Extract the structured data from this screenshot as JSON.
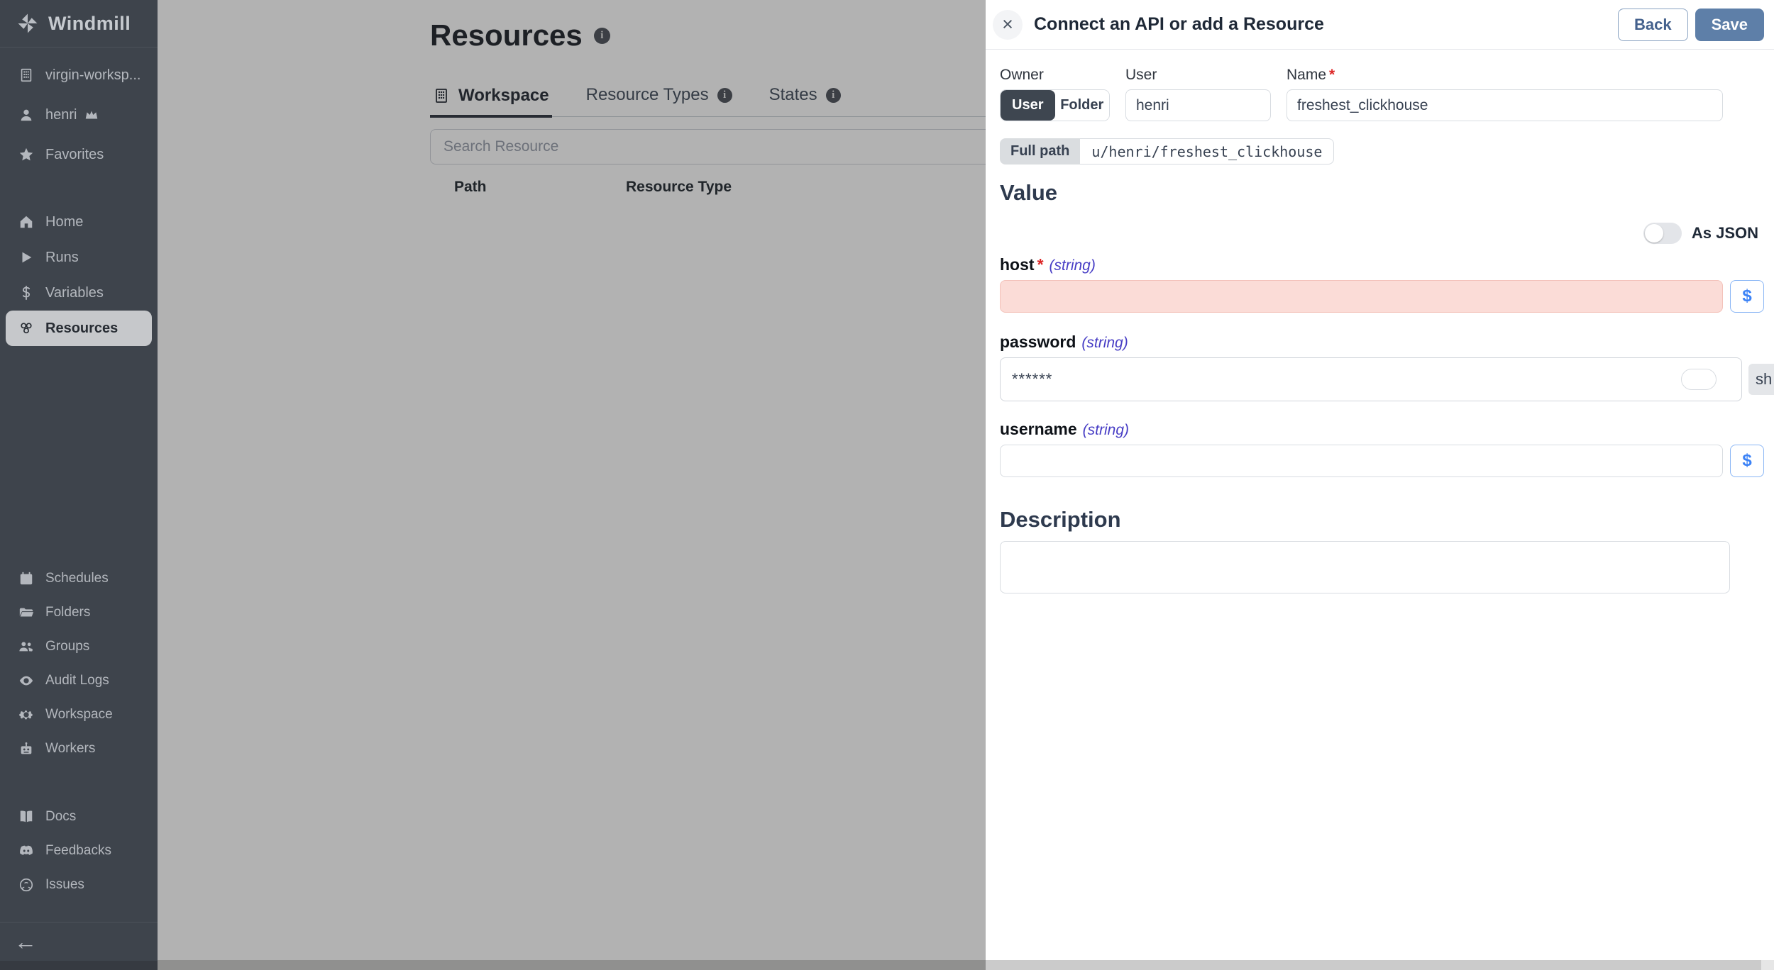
{
  "sidebar": {
    "logo_text": "Windmill",
    "workspace_name": "virgin-worksp...",
    "username": "henri",
    "favorites_label": "Favorites",
    "nav": [
      {
        "label": "Home"
      },
      {
        "label": "Runs"
      },
      {
        "label": "Variables"
      },
      {
        "label": "Resources"
      }
    ],
    "selected_nav": "Resources",
    "tools": [
      {
        "label": "Schedules"
      },
      {
        "label": "Folders"
      },
      {
        "label": "Groups"
      },
      {
        "label": "Audit Logs"
      },
      {
        "label": "Workspace"
      },
      {
        "label": "Workers"
      }
    ],
    "links": [
      {
        "label": "Docs"
      },
      {
        "label": "Feedbacks"
      },
      {
        "label": "Issues"
      }
    ],
    "collapse_icon": "←"
  },
  "main": {
    "title": "Resources",
    "tabs": [
      {
        "label": "Workspace"
      },
      {
        "label": "Resource Types"
      },
      {
        "label": "States"
      }
    ],
    "active_tab": "Workspace",
    "search_placeholder": "Search Resource",
    "table_columns": [
      "Path",
      "Resource Type"
    ]
  },
  "drawer": {
    "title": "Connect an API or add a Resource",
    "back_label": "Back",
    "save_label": "Save",
    "owner_label": "Owner",
    "owner_options": [
      {
        "label": "User",
        "selected": true
      },
      {
        "label": "Folder",
        "selected": false
      }
    ],
    "user_label": "User",
    "user_value": "henri",
    "name_label": "Name",
    "required_mark": "*",
    "name_value": "freshest_clickhouse",
    "full_path_label": "Full path",
    "full_path_value": "u/henri/freshest_clickhouse",
    "value_heading": "Value",
    "as_json_label": "As JSON",
    "fields": {
      "host": {
        "label": "host",
        "required_mark": "*",
        "type_hint": "(string)",
        "value": ""
      },
      "password": {
        "label": "password",
        "type_hint": "(string)",
        "value": "******",
        "show_button_clipped": "sh"
      },
      "username": {
        "label": "username",
        "type_hint": "(string)",
        "value": ""
      }
    },
    "dollar_button": "$",
    "description_heading": "Description",
    "description_value": ""
  },
  "colors": {
    "sidebar_bg": "#3e444c",
    "accent_blue": "#5e7fa8",
    "error_field_bg": "#fbdcd7",
    "type_hint_color": "#473dc5",
    "required_color": "#dc2626",
    "dollar_blue": "#3b82f6"
  }
}
